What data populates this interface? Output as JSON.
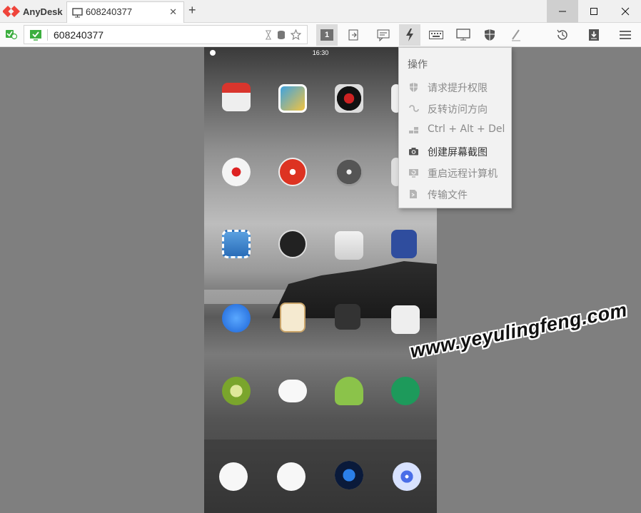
{
  "app": {
    "brand": "AnyDesk"
  },
  "tab": {
    "label": "608240377",
    "close": "✕"
  },
  "newtab": "+",
  "window": {
    "minimize": "—",
    "maximize": "☐",
    "close": "✕"
  },
  "address": {
    "value": "608240377"
  },
  "toolbar": {
    "monitor_badge": "1"
  },
  "phone": {
    "time": "16:30"
  },
  "menu": {
    "title": "操作",
    "items": [
      {
        "label": "请求提升权限",
        "icon": "shield-icon",
        "enabled": false
      },
      {
        "label": "反转访问方向",
        "icon": "switch-arrows-icon",
        "enabled": false
      },
      {
        "label": "Ctrl + Alt + Del",
        "icon": "ctrl-alt-del-icon",
        "enabled": false
      },
      {
        "label": "创建屏幕截图",
        "icon": "camera-icon",
        "enabled": true
      },
      {
        "label": "重启远程计算机",
        "icon": "restart-icon",
        "enabled": false
      },
      {
        "label": "传输文件",
        "icon": "file-transfer-icon",
        "enabled": false
      }
    ]
  },
  "watermark": "www.yeyulingfeng.com",
  "colors": {
    "brand_red": "#ef443b",
    "status_green": "#3cae3f",
    "menu_bg": "#f2f2f2"
  }
}
